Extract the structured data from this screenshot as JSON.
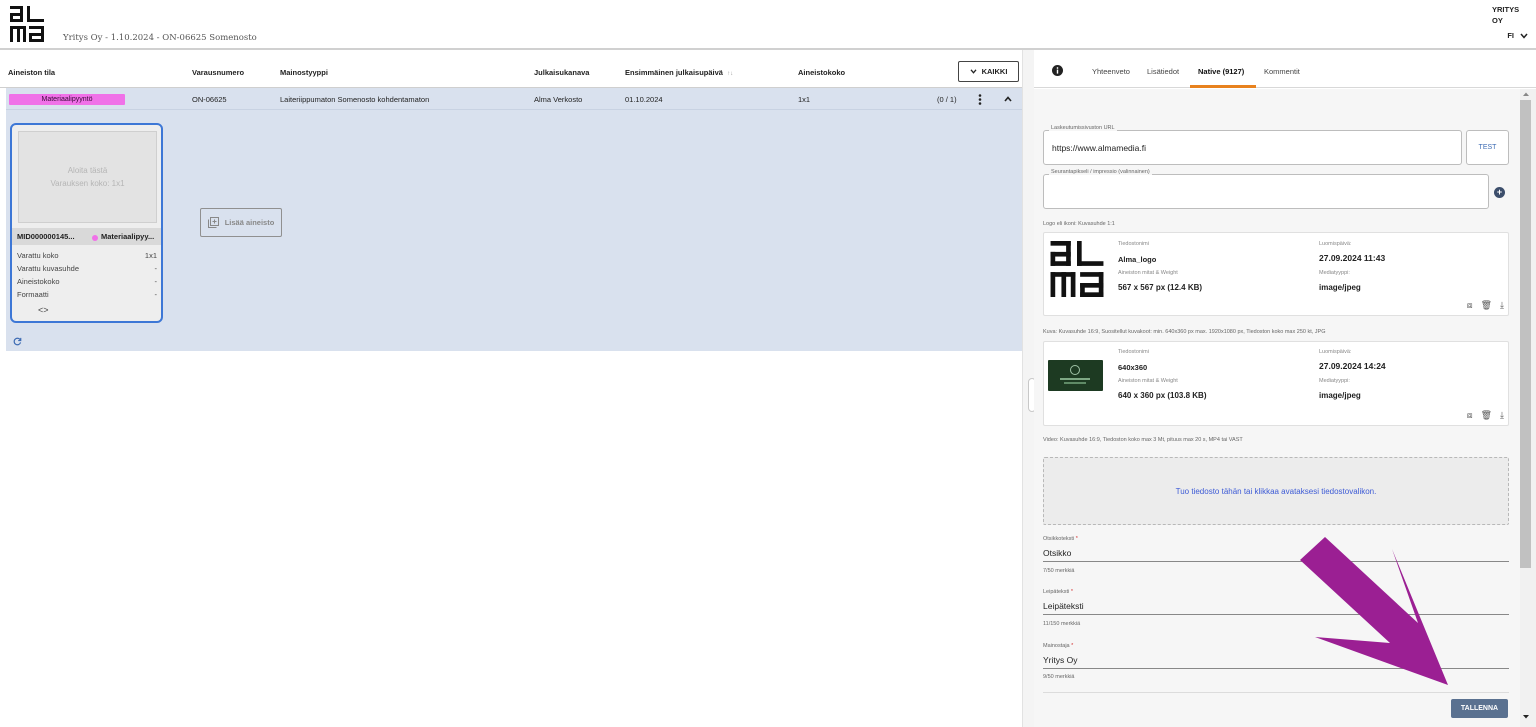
{
  "header": {
    "logo_text": "alma",
    "breadcrumb": "Yritys Oy - 1.10.2024 - ON-06625 Somenosto",
    "company": "YRITYS OY",
    "language": "FI"
  },
  "table": {
    "columns": [
      "Aineiston tila",
      "Varausnumero",
      "Mainostyyppi",
      "Julkaisukanava",
      "Ensimmäinen julkaisupäivä",
      "Aineistokoko"
    ],
    "sort_indicator": "↑↓",
    "filter_button": "KAIKKI",
    "row": {
      "status": "Materiaalipyyntö",
      "reservation": "ON-06625",
      "ad_type": "Laiteriippumaton Somenosto kohdentamaton",
      "channel": "Alma Verkosto",
      "first_date": "01.10.2024",
      "size": "1x1",
      "count": "(0 / 1)"
    }
  },
  "card": {
    "preview_line1": "Aloita tästä",
    "preview_line2": "Varauksen koko: 1x1",
    "id": "MID000000145...",
    "status": "Materiaalipyy...",
    "fields": [
      {
        "label": "Varattu koko",
        "value": "1x1"
      },
      {
        "label": "Varattu kuvasuhde",
        "value": "-"
      },
      {
        "label": "Aineistokoko",
        "value": "-"
      },
      {
        "label": "Formaatti",
        "value": "-"
      }
    ],
    "code_symbol": "<>"
  },
  "add_material_label": "Lisää aineisto",
  "tabs": {
    "info": "i",
    "items": [
      "Yhteenveto",
      "Lisätiedot",
      "Native (9127)",
      "Kommentit"
    ],
    "active": "Native (9127)"
  },
  "form": {
    "landing_label": "Laskeutumissivuston URL",
    "landing_value": "https://www.almamedia.fi",
    "test_button": "TEST",
    "tracking_label": "Seurantapikseli / impressio (valinnainen)",
    "logo_hint": "Logo eli ikoni: Kuvasuhde 1:1",
    "image_hint": "Kuva: Kuvasuhde 16:9, Suositellut kuvakoot: min. 640x360 px max. 1920x1080 px, Tiedoston koko max 250 kt, JPG",
    "video_hint": "Video: Kuvasuhde 16:9, Tiedoston koko max 3 Mt, pituus max 20 s, MP4 tai VAST",
    "files": [
      {
        "filename_label": "Tiedostonimi",
        "filename": "Alma_logo",
        "dims_label": "Aineiston mitat & Weight",
        "dims": "567 x 567 px (12.4 KB)",
        "created_label": "Luomispäivä:",
        "created": "27.09.2024 11:43",
        "type_label": "Mediatyyppi:",
        "type": "image/jpeg"
      },
      {
        "filename_label": "Tiedostonimi",
        "filename": "640x360",
        "dims_label": "Aineiston mitat & Weight",
        "dims": "640 x 360 px (103.8 KB)",
        "created_label": "Luomispäivä:",
        "created": "27.09.2024 14:24",
        "type_label": "Mediatyyppi:",
        "type": "image/jpeg"
      }
    ],
    "dropzone": "Tuo tiedosto tähän tai klikkaa avataksesi tiedostovalikon.",
    "headline_label": "Otsikkoteksti",
    "headline_value": "Otsikko",
    "headline_counter": "7/50 merkkiä",
    "body_label": "Leipäteksti",
    "body_value": "Leipäteksti",
    "body_counter": "11/150 merkkiä",
    "advertiser_label": "Mainostaja",
    "advertiser_value": "Yritys Oy",
    "advertiser_counter": "9/50 merkkiä",
    "required_mark": "*",
    "save_button": "TALLENNA"
  },
  "colors": {
    "status_badge": "#f071e8",
    "selection_bg": "#d9e1ee",
    "card_border": "#3d77d6",
    "tab_accent": "#e8821e",
    "save_button": "#5a7190",
    "arrow": "#9b1f93"
  }
}
